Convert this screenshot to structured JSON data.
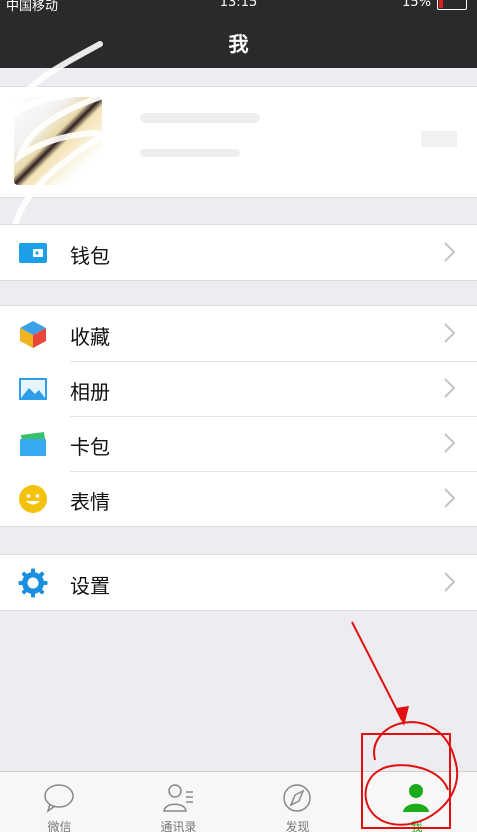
{
  "status_bar": {
    "carrier": "中国移动",
    "time": "13:15",
    "battery": "15%",
    "battery_level": 0.15
  },
  "nav": {
    "title": "我"
  },
  "menu": {
    "wallet": {
      "label": "钱包",
      "icon": "wallet-icon"
    },
    "favorites": {
      "label": "收藏",
      "icon": "cube-icon"
    },
    "album": {
      "label": "相册",
      "icon": "photo-icon"
    },
    "cards": {
      "label": "卡包",
      "icon": "card-icon"
    },
    "stickers": {
      "label": "表情",
      "icon": "smiley-icon"
    },
    "settings": {
      "label": "设置",
      "icon": "gear-icon"
    }
  },
  "tabs": [
    {
      "label": "微信",
      "icon": "chat-bubble-icon"
    },
    {
      "label": "通讯录",
      "icon": "contacts-icon"
    },
    {
      "label": "发现",
      "icon": "compass-icon"
    },
    {
      "label": "我",
      "icon": "person-icon"
    }
  ],
  "colors": {
    "nav_bg": "#2a2a2c",
    "active_tab": "#1aad19",
    "annotation_red": "#e01010",
    "wallet_blue": "#1d9fe8",
    "sticker_yellow": "#f4c20d",
    "settings_blue": "#1a8fe0"
  }
}
